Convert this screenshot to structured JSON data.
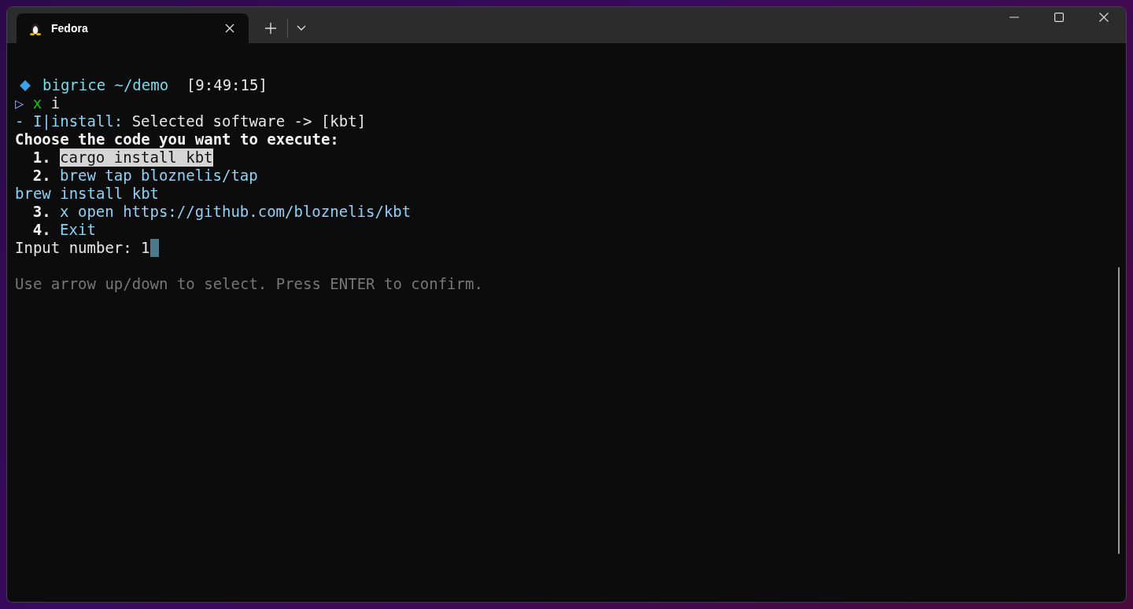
{
  "window": {
    "tab": {
      "title": "Fedora",
      "selected": true
    }
  },
  "terminal": {
    "prompt": {
      "user": "bigrice",
      "path": "~/demo",
      "time": "[9:49:15]"
    },
    "command": {
      "symbol": "▷",
      "program": "x",
      "args": "i"
    },
    "info": {
      "prefix": "- I|install:",
      "text": "Selected software -> [kbt]"
    },
    "question": "Choose the code you want to execute:",
    "options": [
      {
        "number": "1.",
        "lines": [
          "cargo install kbt"
        ],
        "selected": true
      },
      {
        "number": "2.",
        "lines": [
          "brew tap bloznelis/tap",
          "brew install kbt"
        ],
        "selected": false
      },
      {
        "number": "3.",
        "lines": [
          "x open https://github.com/bloznelis/kbt"
        ],
        "selected": false
      },
      {
        "number": "4.",
        "lines": [
          "Exit"
        ],
        "selected": false
      }
    ],
    "input": {
      "label": "Input number:",
      "value": "1"
    },
    "hint": "Use arrow up/down to select. Press ENTER to confirm."
  }
}
